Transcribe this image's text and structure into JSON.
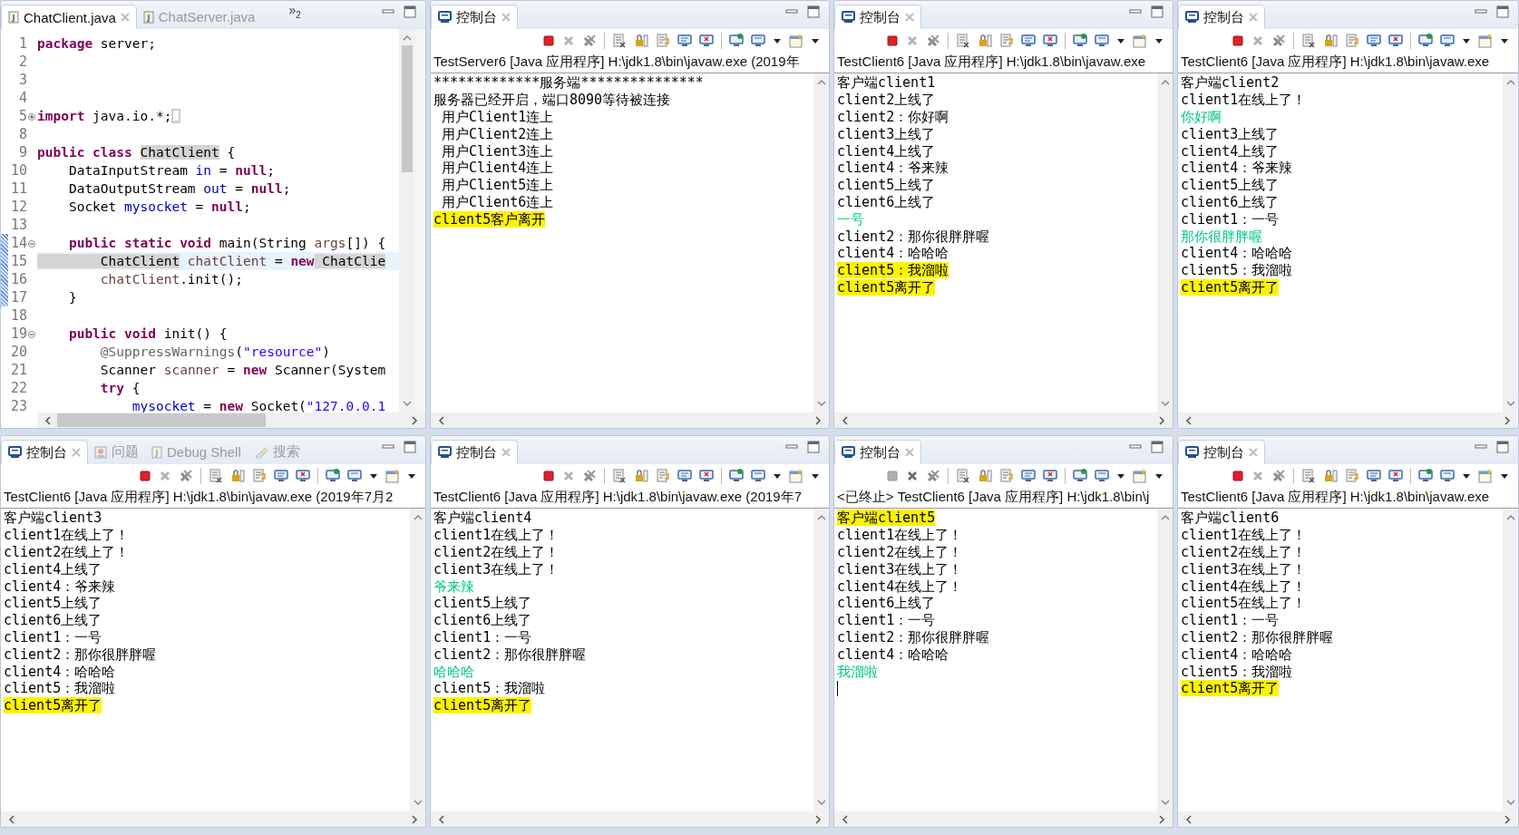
{
  "panels": [
    {
      "kind": "editor",
      "tabs": [
        {
          "label": "ChatClient.java",
          "kind": "java",
          "selected": true
        },
        {
          "label": "ChatServer.java",
          "kind": "java",
          "selected": false
        }
      ],
      "overflow": {
        "icon": "»",
        "count": "2"
      },
      "lines": [
        {
          "number": "1",
          "selected": false,
          "tokens": [
            {
              "text": "package",
              "kind": "kw"
            },
            {
              "text": " server;",
              "kind": "plain"
            }
          ]
        },
        {
          "number": "2",
          "selected": false
        },
        {
          "number": "3",
          "selected": false
        },
        {
          "number": "4",
          "selected": false
        },
        {
          "number": "5",
          "collapsed": true,
          "selected": false,
          "tokens": [
            {
              "text": "import",
              "kind": "kw"
            },
            {
              "text": " java.io.*;",
              "kind": "plain"
            }
          ]
        },
        {
          "number": "8",
          "selected": false
        },
        {
          "number": "9",
          "selected": false,
          "tokens": [
            {
              "text": "public class ",
              "kind": "kw"
            },
            {
              "text": "ChatClient",
              "kind": "occ"
            },
            {
              "text": " {",
              "kind": "plain"
            }
          ]
        },
        {
          "number": "10",
          "selected": false,
          "tokens": [
            {
              "text": "    DataInputStream ",
              "kind": "plain"
            },
            {
              "text": "in",
              "kind": "field"
            },
            {
              "text": " = ",
              "kind": "plain"
            },
            {
              "text": "null",
              "kind": "kw"
            },
            {
              "text": ";",
              "kind": "plain"
            }
          ]
        },
        {
          "number": "11",
          "selected": false,
          "tokens": [
            {
              "text": "    DataOutputStream ",
              "kind": "plain"
            },
            {
              "text": "out",
              "kind": "field"
            },
            {
              "text": " = ",
              "kind": "plain"
            },
            {
              "text": "null",
              "kind": "kw"
            },
            {
              "text": ";",
              "kind": "plain"
            }
          ]
        },
        {
          "number": "12",
          "selected": false,
          "tokens": [
            {
              "text": "    Socket ",
              "kind": "plain"
            },
            {
              "text": "mysocket",
              "kind": "field"
            },
            {
              "text": " = ",
              "kind": "plain"
            },
            {
              "text": "null",
              "kind": "kw"
            },
            {
              "text": ";",
              "kind": "plain"
            }
          ]
        },
        {
          "number": "13",
          "selected": false
        },
        {
          "number": "14",
          "collapsed": false,
          "selected": false,
          "tokens": [
            {
              "text": "    public static void",
              "kind": "kw"
            },
            {
              "text": " main(String ",
              "kind": "plain"
            },
            {
              "text": "args",
              "kind": "local"
            },
            {
              "text": "[]) {",
              "kind": "plain"
            }
          ]
        },
        {
          "number": "15",
          "selected": true,
          "tokens": [
            {
              "text": "        ChatClient",
              "kind": "occ"
            },
            {
              "text": " chatClient",
              "kind": "local"
            },
            {
              "text": " = ",
              "kind": "plain"
            },
            {
              "text": "new",
              "kind": "kw"
            },
            {
              "text": " ChatClie",
              "kind": "occ"
            }
          ]
        },
        {
          "number": "16",
          "selected": false,
          "tokens": [
            {
              "text": "        chatClient",
              "kind": "local"
            },
            {
              "text": ".init();",
              "kind": "plain"
            }
          ]
        },
        {
          "number": "17",
          "selected": false,
          "tokens": [
            {
              "text": "    }",
              "kind": "plain"
            }
          ]
        },
        {
          "number": "18",
          "selected": false
        },
        {
          "number": "19",
          "collapsed": false,
          "selected": false,
          "tokens": [
            {
              "text": "    public void",
              "kind": "kw"
            },
            {
              "text": " init() {",
              "kind": "plain"
            }
          ]
        },
        {
          "number": "20",
          "selected": false,
          "tokens": [
            {
              "text": "        @SuppressWarnings",
              "kind": "ann"
            },
            {
              "text": "(",
              "kind": "plain"
            },
            {
              "text": "\"resource\"",
              "kind": "str"
            },
            {
              "text": ")",
              "kind": "plain"
            }
          ]
        },
        {
          "number": "21",
          "selected": false,
          "tokens": [
            {
              "text": "        Scanner ",
              "kind": "plain"
            },
            {
              "text": "scanner",
              "kind": "local"
            },
            {
              "text": " = ",
              "kind": "plain"
            },
            {
              "text": "new",
              "kind": "kw"
            },
            {
              "text": " Scanner(System",
              "kind": "plain"
            }
          ]
        },
        {
          "number": "22",
          "selected": false,
          "tokens": [
            {
              "text": "        try",
              "kind": "kw"
            },
            {
              "text": " {",
              "kind": "plain"
            }
          ]
        },
        {
          "number": "23",
          "selected": false,
          "tokens": [
            {
              "text": "            mysocket",
              "kind": "field"
            },
            {
              "text": " = ",
              "kind": "plain"
            },
            {
              "text": "new",
              "kind": "kw"
            },
            {
              "text": " Socket(",
              "kind": "plain"
            },
            {
              "text": "\"127.0.0.1",
              "kind": "str"
            }
          ]
        }
      ]
    },
    {
      "kind": "console",
      "tabs": [
        {
          "label": "控制台",
          "kind": "console",
          "selected": true
        }
      ],
      "terminated": false,
      "title": "TestServer6 [Java 应用程序] H:\\jdk1.8\\bin\\javaw.exe  (2019年",
      "output": [
        {
          "text": "*************服务端***************",
          "kind": "output",
          "highlighted": false
        },
        {
          "text": "服务器已经开启，端口8090等待被连接",
          "kind": "output",
          "highlighted": false
        },
        {
          "text": " 用户Client1连上",
          "kind": "output",
          "highlighted": false
        },
        {
          "text": " 用户Client2连上",
          "kind": "output",
          "highlighted": false
        },
        {
          "text": " 用户Client3连上",
          "kind": "output",
          "highlighted": false
        },
        {
          "text": " 用户Client4连上",
          "kind": "output",
          "highlighted": false
        },
        {
          "text": " 用户Client5连上",
          "kind": "output",
          "highlighted": false
        },
        {
          "text": " 用户Client6连上",
          "kind": "output",
          "highlighted": false
        },
        {
          "text": "client5客户离开",
          "kind": "output",
          "highlighted": true
        }
      ]
    },
    {
      "kind": "console",
      "tabs": [
        {
          "label": "控制台",
          "kind": "console",
          "selected": true
        }
      ],
      "terminated": false,
      "title": "TestClient6 [Java 应用程序] H:\\jdk1.8\\bin\\javaw.exe",
      "output": [
        {
          "text": "客户端client1",
          "kind": "output",
          "highlighted": false
        },
        {
          "text": "client2上线了",
          "kind": "output",
          "highlighted": false
        },
        {
          "text": "client2：你好啊",
          "kind": "output",
          "highlighted": false
        },
        {
          "text": "client3上线了",
          "kind": "output",
          "highlighted": false
        },
        {
          "text": "client4上线了",
          "kind": "output",
          "highlighted": false
        },
        {
          "text": "client4：爷来辣",
          "kind": "output",
          "highlighted": false
        },
        {
          "text": "client5上线了",
          "kind": "output",
          "highlighted": false
        },
        {
          "text": "client6上线了",
          "kind": "output",
          "highlighted": false
        },
        {
          "text": "一号",
          "kind": "input",
          "highlighted": false
        },
        {
          "text": "client2：那你很胖胖喔",
          "kind": "output",
          "highlighted": false
        },
        {
          "text": "client4：哈哈哈",
          "kind": "output",
          "highlighted": false
        },
        {
          "text": "client5：我溜啦",
          "kind": "output",
          "highlighted": true
        },
        {
          "text": "client5离开了",
          "kind": "output",
          "highlighted": true
        }
      ]
    },
    {
      "kind": "console",
      "tabs": [
        {
          "label": "控制台",
          "kind": "console",
          "selected": true
        }
      ],
      "terminated": false,
      "title": "TestClient6 [Java 应用程序] H:\\jdk1.8\\bin\\javaw.exe",
      "output": [
        {
          "text": "客户端client2",
          "kind": "output",
          "highlighted": false
        },
        {
          "text": "client1在线上了！",
          "kind": "output",
          "highlighted": false
        },
        {
          "text": "你好啊",
          "kind": "input",
          "highlighted": false
        },
        {
          "text": "client3上线了",
          "kind": "output",
          "highlighted": false
        },
        {
          "text": "client4上线了",
          "kind": "output",
          "highlighted": false
        },
        {
          "text": "client4：爷来辣",
          "kind": "output",
          "highlighted": false
        },
        {
          "text": "client5上线了",
          "kind": "output",
          "highlighted": false
        },
        {
          "text": "client6上线了",
          "kind": "output",
          "highlighted": false
        },
        {
          "text": "client1：一号",
          "kind": "output",
          "highlighted": false
        },
        {
          "text": "那你很胖胖喔",
          "kind": "input",
          "highlighted": false
        },
        {
          "text": "client4：哈哈哈",
          "kind": "output",
          "highlighted": false
        },
        {
          "text": "client5：我溜啦",
          "kind": "output",
          "highlighted": false
        },
        {
          "text": "client5离开了",
          "kind": "output",
          "highlighted": true
        }
      ]
    },
    {
      "kind": "console",
      "tabs": [
        {
          "label": "控制台",
          "kind": "console",
          "selected": true
        },
        {
          "label": "问题",
          "kind": "problems",
          "selected": false
        },
        {
          "label": "Debug Shell",
          "kind": "shell",
          "selected": false
        },
        {
          "label": "搜索",
          "kind": "search",
          "selected": false
        }
      ],
      "terminated": false,
      "title": "TestClient6 [Java 应用程序] H:\\jdk1.8\\bin\\javaw.exe  (2019年7月2",
      "output": [
        {
          "text": "客户端client3",
          "kind": "output",
          "highlighted": false
        },
        {
          "text": "client1在线上了！",
          "kind": "output",
          "highlighted": false
        },
        {
          "text": "client2在线上了！",
          "kind": "output",
          "highlighted": false
        },
        {
          "text": "client4上线了",
          "kind": "output",
          "highlighted": false
        },
        {
          "text": "client4：爷来辣",
          "kind": "output",
          "highlighted": false
        },
        {
          "text": "client5上线了",
          "kind": "output",
          "highlighted": false
        },
        {
          "text": "client6上线了",
          "kind": "output",
          "highlighted": false
        },
        {
          "text": "client1：一号",
          "kind": "output",
          "highlighted": false
        },
        {
          "text": "client2：那你很胖胖喔",
          "kind": "output",
          "highlighted": false
        },
        {
          "text": "client4：哈哈哈",
          "kind": "output",
          "highlighted": false
        },
        {
          "text": "client5：我溜啦",
          "kind": "output",
          "highlighted": false
        },
        {
          "text": "client5离开了",
          "kind": "output",
          "highlighted": true
        }
      ]
    },
    {
      "kind": "console",
      "tabs": [
        {
          "label": "控制台",
          "kind": "console",
          "selected": true
        }
      ],
      "terminated": false,
      "title": "TestClient6 [Java 应用程序] H:\\jdk1.8\\bin\\javaw.exe  (2019年7",
      "output": [
        {
          "text": "客户端client4",
          "kind": "output",
          "highlighted": false
        },
        {
          "text": "client1在线上了！",
          "kind": "output",
          "highlighted": false
        },
        {
          "text": "client2在线上了！",
          "kind": "output",
          "highlighted": false
        },
        {
          "text": "client3在线上了！",
          "kind": "output",
          "highlighted": false
        },
        {
          "text": "爷来辣",
          "kind": "input",
          "highlighted": false
        },
        {
          "text": "client5上线了",
          "kind": "output",
          "highlighted": false
        },
        {
          "text": "client6上线了",
          "kind": "output",
          "highlighted": false
        },
        {
          "text": "client1：一号",
          "kind": "output",
          "highlighted": false
        },
        {
          "text": "client2：那你很胖胖喔",
          "kind": "output",
          "highlighted": false
        },
        {
          "text": "哈哈哈",
          "kind": "input",
          "highlighted": false
        },
        {
          "text": "client5：我溜啦",
          "kind": "output",
          "highlighted": false
        },
        {
          "text": "client5离开了",
          "kind": "output",
          "highlighted": true
        }
      ]
    },
    {
      "kind": "console",
      "tabs": [
        {
          "label": "控制台",
          "kind": "console",
          "selected": true
        }
      ],
      "terminated": true,
      "cursor": true,
      "title": "<已终止> TestClient6 [Java 应用程序] H:\\jdk1.8\\bin\\j",
      "output": [
        {
          "text": "客户端client5",
          "kind": "output",
          "highlighted": true
        },
        {
          "text": "client1在线上了！",
          "kind": "output",
          "highlighted": false
        },
        {
          "text": "client2在线上了！",
          "kind": "output",
          "highlighted": false
        },
        {
          "text": "client3在线上了！",
          "kind": "output",
          "highlighted": false
        },
        {
          "text": "client4在线上了！",
          "kind": "output",
          "highlighted": false
        },
        {
          "text": "client6上线了",
          "kind": "output",
          "highlighted": false
        },
        {
          "text": "client1：一号",
          "kind": "output",
          "highlighted": false
        },
        {
          "text": "client2：那你很胖胖喔",
          "kind": "output",
          "highlighted": false
        },
        {
          "text": "client4：哈哈哈",
          "kind": "output",
          "highlighted": false
        },
        {
          "text": "我溜啦",
          "kind": "input",
          "highlighted": false
        }
      ]
    },
    {
      "kind": "console",
      "tabs": [
        {
          "label": "控制台",
          "kind": "console",
          "selected": true
        }
      ],
      "terminated": false,
      "title": "TestClient6 [Java 应用程序] H:\\jdk1.8\\bin\\javaw.exe",
      "output": [
        {
          "text": "客户端client6",
          "kind": "output",
          "highlighted": false
        },
        {
          "text": "client1在线上了！",
          "kind": "output",
          "highlighted": false
        },
        {
          "text": "client2在线上了！",
          "kind": "output",
          "highlighted": false
        },
        {
          "text": "client3在线上了！",
          "kind": "output",
          "highlighted": false
        },
        {
          "text": "client4在线上了！",
          "kind": "output",
          "highlighted": false
        },
        {
          "text": "client5在线上了！",
          "kind": "output",
          "highlighted": false
        },
        {
          "text": "client1：一号",
          "kind": "output",
          "highlighted": false
        },
        {
          "text": "client2：那你很胖胖喔",
          "kind": "output",
          "highlighted": false
        },
        {
          "text": "client4：哈哈哈",
          "kind": "output",
          "highlighted": false
        },
        {
          "text": "client5：我溜啦",
          "kind": "output",
          "highlighted": false
        },
        {
          "text": "client5离开了",
          "kind": "output",
          "highlighted": true
        }
      ]
    }
  ]
}
